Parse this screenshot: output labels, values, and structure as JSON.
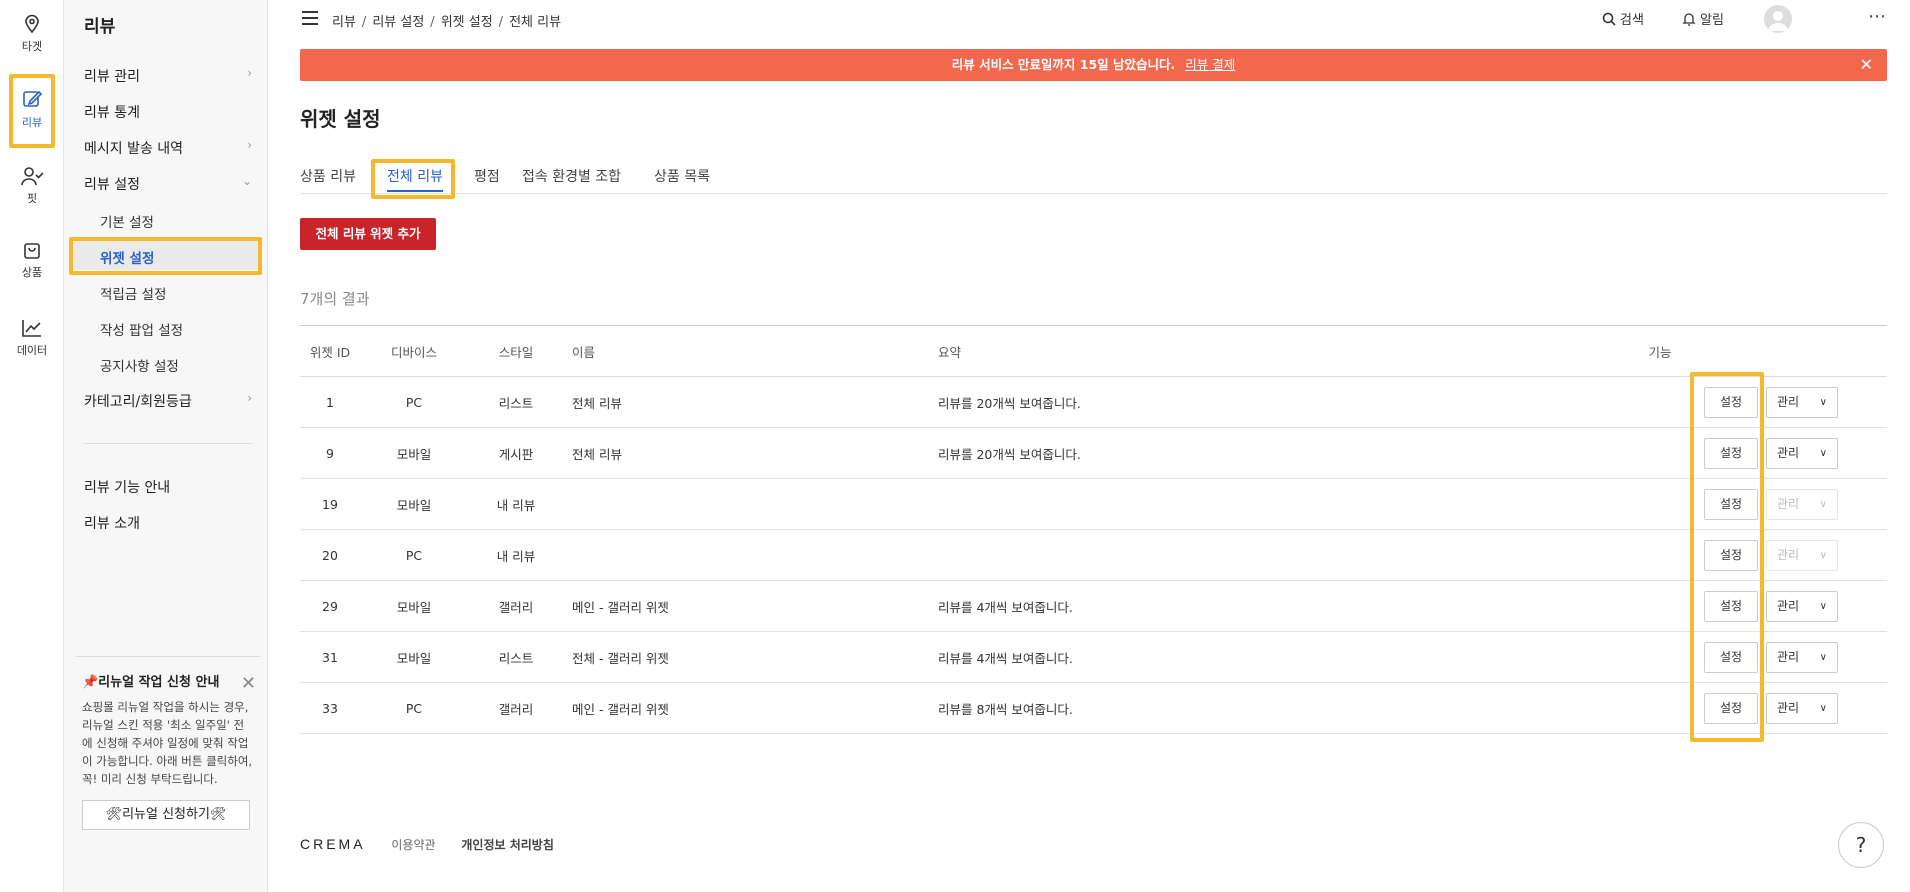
{
  "rail": {
    "items": [
      {
        "label": "타겟",
        "icon": "location-pin-icon"
      },
      {
        "label": "리뷰",
        "icon": "edit-icon"
      },
      {
        "label": "핏",
        "icon": "user-check-icon"
      },
      {
        "label": "상품",
        "icon": "shopping-bag-icon"
      },
      {
        "label": "데이터",
        "icon": "line-chart-icon"
      }
    ],
    "active_color": "#2b61c7"
  },
  "sidebar": {
    "title": "리뷰",
    "items": [
      {
        "label": "리뷰 관리",
        "chevron": "›"
      },
      {
        "label": "리뷰 통계",
        "chevron": ""
      },
      {
        "label": "메시지 발송 내역",
        "chevron": "›"
      },
      {
        "label": "리뷰 설정",
        "chevron": "⌄"
      }
    ],
    "sub_items": [
      {
        "label": "기본 설정"
      },
      {
        "label": "위젯 설정"
      },
      {
        "label": "적립금 설정"
      },
      {
        "label": "작성 팝업 설정"
      },
      {
        "label": "공지사항 설정"
      }
    ],
    "category_item": {
      "label": "카테고리/회원등급",
      "chevron": "›"
    },
    "bottom_links": [
      {
        "label": "리뷰 기능 안내"
      },
      {
        "label": "리뷰 소개"
      }
    ],
    "notice": {
      "title": "📌리뉴얼 작업 신청 안내",
      "close": "✕",
      "body": "쇼핑몰 리뉴얼 작업을 하시는 경우, 리뉴얼 스킨 적용 '최소 일주일' 전에 신청해 주셔야 일정에 맞춰 작업이 가능합니다. 아래 버튼 클릭하여, 꼭! 미리 신청 부탁드립니다.",
      "button": "🛠리뉴얼 신청하기🛠"
    }
  },
  "topbar": {
    "breadcrumb": [
      "리뷰",
      "리뷰 설정",
      "위젯 설정",
      "전체 리뷰"
    ],
    "breadcrumb_sep": "/",
    "search_label": "검색",
    "alarm_label": "알림",
    "more": "⋯"
  },
  "banner": {
    "text": "리뷰 서비스 만료일까지 15일 남았습니다.",
    "link": "리뷰 결제",
    "close": "✕",
    "color": "#f2684f"
  },
  "page": {
    "title": "위젯 설정",
    "tabs": [
      {
        "label": "상품 리뷰"
      },
      {
        "label": "전체 리뷰"
      },
      {
        "label": "평점"
      },
      {
        "label": "접속 환경별 조합"
      },
      {
        "label": "상품 목록"
      }
    ],
    "add_button": "전체 리뷰 위젯 추가",
    "add_button_color": "#c8242a",
    "result_count": "7개의 결과"
  },
  "table": {
    "headers": {
      "id": "위젯 ID",
      "device": "디바이스",
      "style": "스타일",
      "name": "이름",
      "summary": "요약",
      "function": "기능"
    },
    "set_label": "설정",
    "manage_label": "관리",
    "rows": [
      {
        "id": "1",
        "device": "PC",
        "style": "리스트",
        "name": "전체 리뷰",
        "summary": "리뷰를 20개씩 보여줍니다.",
        "manage_disabled": false
      },
      {
        "id": "9",
        "device": "모바일",
        "style": "게시판",
        "name": "전체 리뷰",
        "summary": "리뷰를 20개씩 보여줍니다.",
        "manage_disabled": false
      },
      {
        "id": "19",
        "device": "모바일",
        "style": "내 리뷰",
        "name": "",
        "summary": "",
        "manage_disabled": true
      },
      {
        "id": "20",
        "device": "PC",
        "style": "내 리뷰",
        "name": "",
        "summary": "",
        "manage_disabled": true
      },
      {
        "id": "29",
        "device": "모바일",
        "style": "갤러리",
        "name": "메인 - 갤러리 위젯",
        "summary": "리뷰를 4개씩 보여줍니다.",
        "manage_disabled": false
      },
      {
        "id": "31",
        "device": "모바일",
        "style": "리스트",
        "name": "전체 - 갤러리 위젯",
        "summary": "리뷰를 4개씩 보여줍니다.",
        "manage_disabled": false
      },
      {
        "id": "33",
        "device": "PC",
        "style": "갤러리",
        "name": "메인 - 갤러리 위젯",
        "summary": "리뷰를 8개씩 보여줍니다.",
        "manage_disabled": false
      }
    ]
  },
  "footer": {
    "logo": "CREMA",
    "terms": "이용약관",
    "privacy": "개인정보 처리방침"
  },
  "help": "?",
  "highlight_color": "#f5b92e"
}
